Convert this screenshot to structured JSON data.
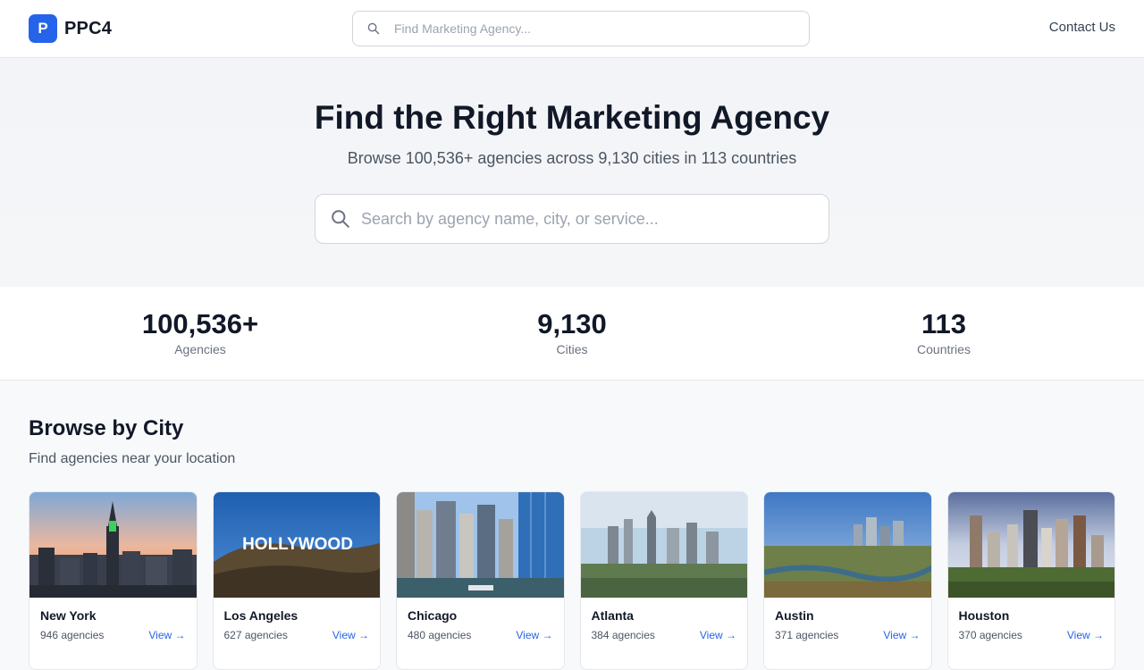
{
  "header": {
    "logo_letter": "P",
    "logo_text": "PPC4",
    "search_placeholder": "Find Marketing Agency...",
    "contact_label": "Contact Us"
  },
  "hero": {
    "title": "Find the Right Marketing Agency",
    "subtitle": "Browse 100,536+ agencies across 9,130 cities in 113 countries",
    "search_placeholder": "Search by agency name, city, or service..."
  },
  "stats": [
    {
      "value": "100,536+",
      "label": "Agencies"
    },
    {
      "value": "9,130",
      "label": "Cities"
    },
    {
      "value": "113",
      "label": "Countries"
    }
  ],
  "browse": {
    "title": "Browse by City",
    "subtitle": "Find agencies near your location",
    "cities": [
      {
        "name": "New York",
        "count": "946 agencies",
        "view": "View →"
      },
      {
        "name": "Los Angeles",
        "count": "627 agencies",
        "view": "View →",
        "sign_text": "HOLLYWOOD"
      },
      {
        "name": "Chicago",
        "count": "480 agencies",
        "view": "View →"
      },
      {
        "name": "Atlanta",
        "count": "384 agencies",
        "view": "View →"
      },
      {
        "name": "Austin",
        "count": "371 agencies",
        "view": "View →"
      },
      {
        "name": "Houston",
        "count": "370 agencies",
        "view": "View →"
      }
    ]
  },
  "colors": {
    "accent": "#2563eb",
    "text": "#111827",
    "muted": "#6b7280"
  },
  "icons": {
    "search": "search-icon"
  }
}
